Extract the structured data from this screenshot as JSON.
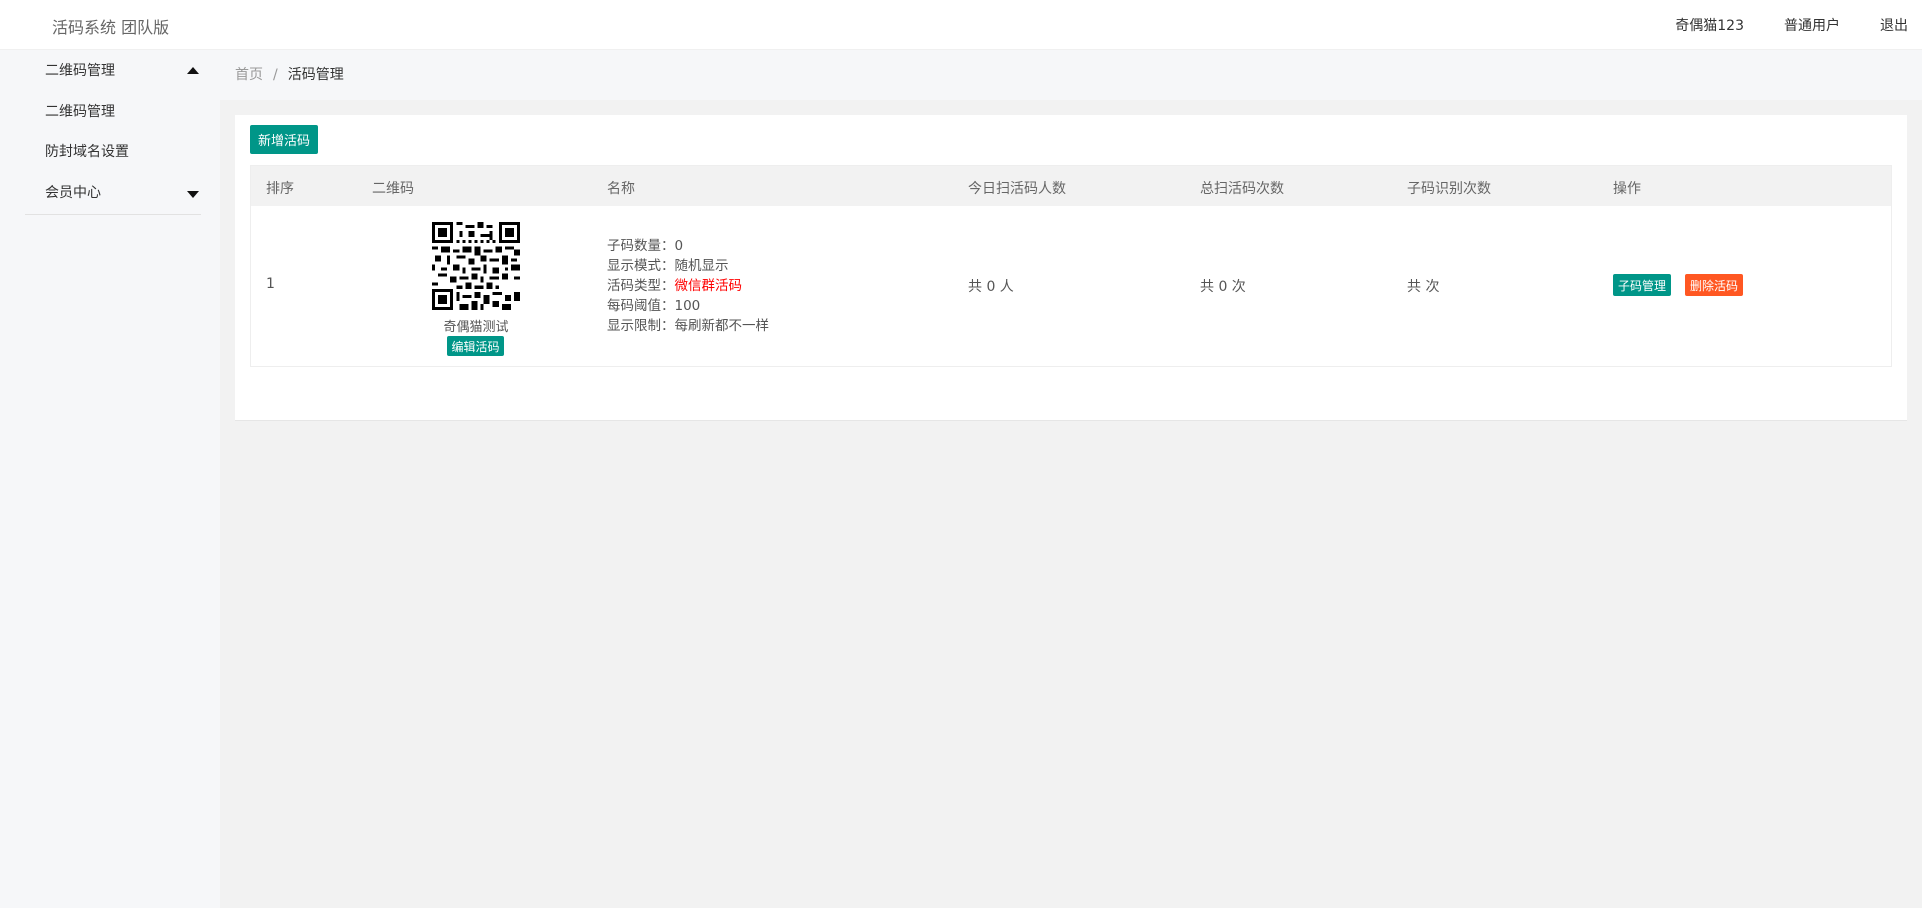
{
  "header": {
    "logo": "活码系统 团队版",
    "username": "奇偶猫123",
    "role": "普通用户",
    "logout": "退出"
  },
  "sidebar": {
    "group1": {
      "title": "二维码管理",
      "items": [
        "二维码管理",
        "防封域名设置"
      ]
    },
    "group2": {
      "title": "会员中心"
    }
  },
  "breadcrumb": {
    "home": "首页",
    "separator": "/",
    "current": "活码管理"
  },
  "toolbar": {
    "add_label": "新增活码"
  },
  "table": {
    "headers": [
      "排序",
      "二维码",
      "名称",
      "今日扫活码人数",
      "总扫活码次数",
      "子码识别次数",
      "操作"
    ],
    "rows": [
      {
        "order": "1",
        "qr_name": "奇偶猫测试",
        "edit_label": "编辑活码",
        "info": {
          "sub_count_label": "子码数量：",
          "sub_count": "0",
          "mode_label": "显示模式：",
          "mode": "随机显示",
          "type_label": "活码类型：",
          "type": "微信群活码",
          "threshold_label": "每码阈值：",
          "threshold": "100",
          "limit_label": "显示限制：",
          "limit": "每刷新都不一样"
        },
        "today_scans": "共 0 人",
        "total_scans": "共 0 次",
        "sub_recognitions": "共 次",
        "action_sub": "子码管理",
        "action_delete": "删除活码"
      }
    ]
  },
  "colors": {
    "primary": "#009688",
    "danger": "#ff5722",
    "highlight": "#ff0000"
  }
}
